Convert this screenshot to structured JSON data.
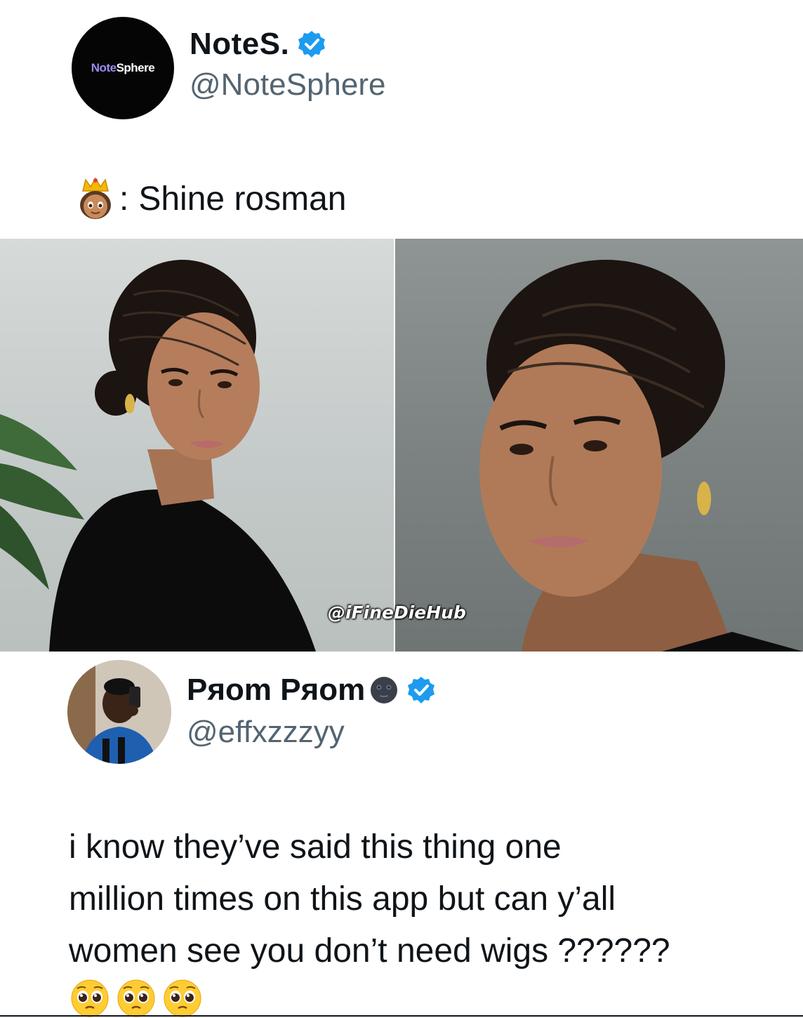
{
  "original_post": {
    "display_name": "NoteS.",
    "handle": "@NoteSphere",
    "avatar_logo": {
      "part1": "Note",
      "part2": "Sphere"
    },
    "verified": true,
    "caption_emoji": "crown-woman-emoji",
    "caption_text": "Shine rosman",
    "caption_prefix": ":"
  },
  "photos": {
    "watermark": "@iFineDieHub",
    "count": 2
  },
  "reply": {
    "display_name": "Pяom Pяom",
    "name_emoji": "new-moon-face-emoji",
    "handle": "@effxzzzyy",
    "verified": true,
    "text_lines": [
      "i know they’ve said this thing one",
      "million times on this app but can y’all",
      "women see you don’t need wigs ??????"
    ],
    "trailing_emojis": [
      "pleading-face-emoji",
      "pleading-face-emoji",
      "pleading-face-emoji"
    ]
  },
  "colors": {
    "verified_blue": "#1d9bf0",
    "text_primary": "#0f1419",
    "text_secondary": "#536471"
  }
}
